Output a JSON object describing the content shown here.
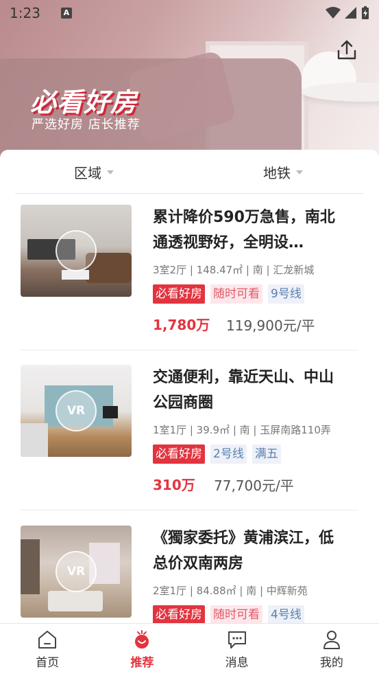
{
  "status": {
    "time": "1:23",
    "notif_icon": "A"
  },
  "hero": {
    "title": "必看好房",
    "subtitle": "严选好房 店长推荐"
  },
  "filters": {
    "area": "区域",
    "subway": "地铁"
  },
  "listings": [
    {
      "title": "累计降价590万急售，南北通透视野好，全明设…",
      "meta": "3室2厅 | 148.47㎡ | 南 | 汇龙新城",
      "tags": [
        "必看好房",
        "随时可看",
        "9号线"
      ],
      "price": "1,780万",
      "unit_price": "119,900元/平",
      "vr": false
    },
    {
      "title": "交通便利，靠近天山、中山公园商圈",
      "meta": "1室1厅 | 39.9㎡ | 南 | 玉屏南路110弄",
      "tags": [
        "必看好房",
        "2号线",
        "满五"
      ],
      "price": "310万",
      "unit_price": "77,700元/平",
      "vr": true
    },
    {
      "title": "《獨家委托》黄浦滨江，低总价双南两房",
      "meta": "2室1厅 | 84.88㎡ | 南 | 中辉新苑",
      "tags": [
        "必看好房",
        "随时可看",
        "4号线"
      ],
      "price": "",
      "unit_price": "",
      "vr": true
    }
  ],
  "vr_label": "VR",
  "tabs": [
    {
      "label": "首页",
      "icon": "home-icon",
      "active": false
    },
    {
      "label": "推荐",
      "icon": "recommend-icon",
      "active": true
    },
    {
      "label": "消息",
      "icon": "message-icon",
      "active": false
    },
    {
      "label": "我的",
      "icon": "user-icon",
      "active": false
    }
  ],
  "colors": {
    "accent": "#e2343f",
    "tag_pink_bg": "#fde7ea",
    "tag_blue_bg": "#eef1f7"
  }
}
